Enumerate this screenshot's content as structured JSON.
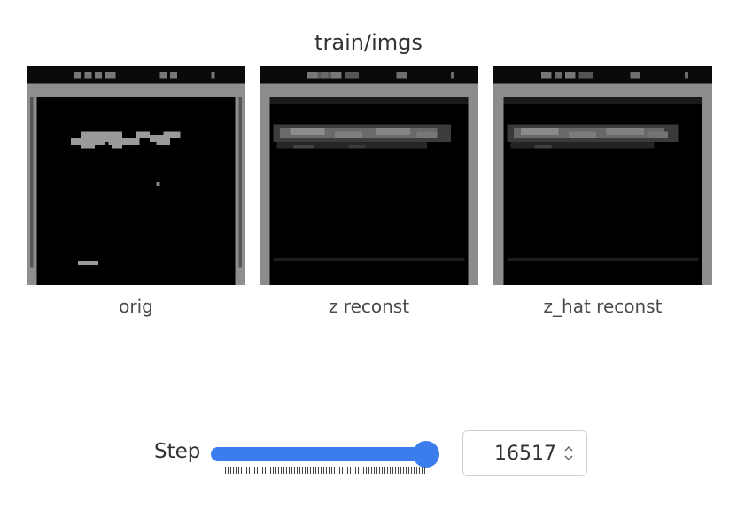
{
  "panel": {
    "title": "train/imgs"
  },
  "images": [
    {
      "caption": "orig",
      "kind": "original"
    },
    {
      "caption": "z reconst",
      "kind": "reconstruction"
    },
    {
      "caption": "z_hat reconst",
      "kind": "reconstruction"
    }
  ],
  "step_control": {
    "label": "Step",
    "value": "16517",
    "slider_fraction": 1.0,
    "accent_color": "#3b7ded"
  },
  "icons": {
    "spinner": "up-down-chevron-icon"
  }
}
